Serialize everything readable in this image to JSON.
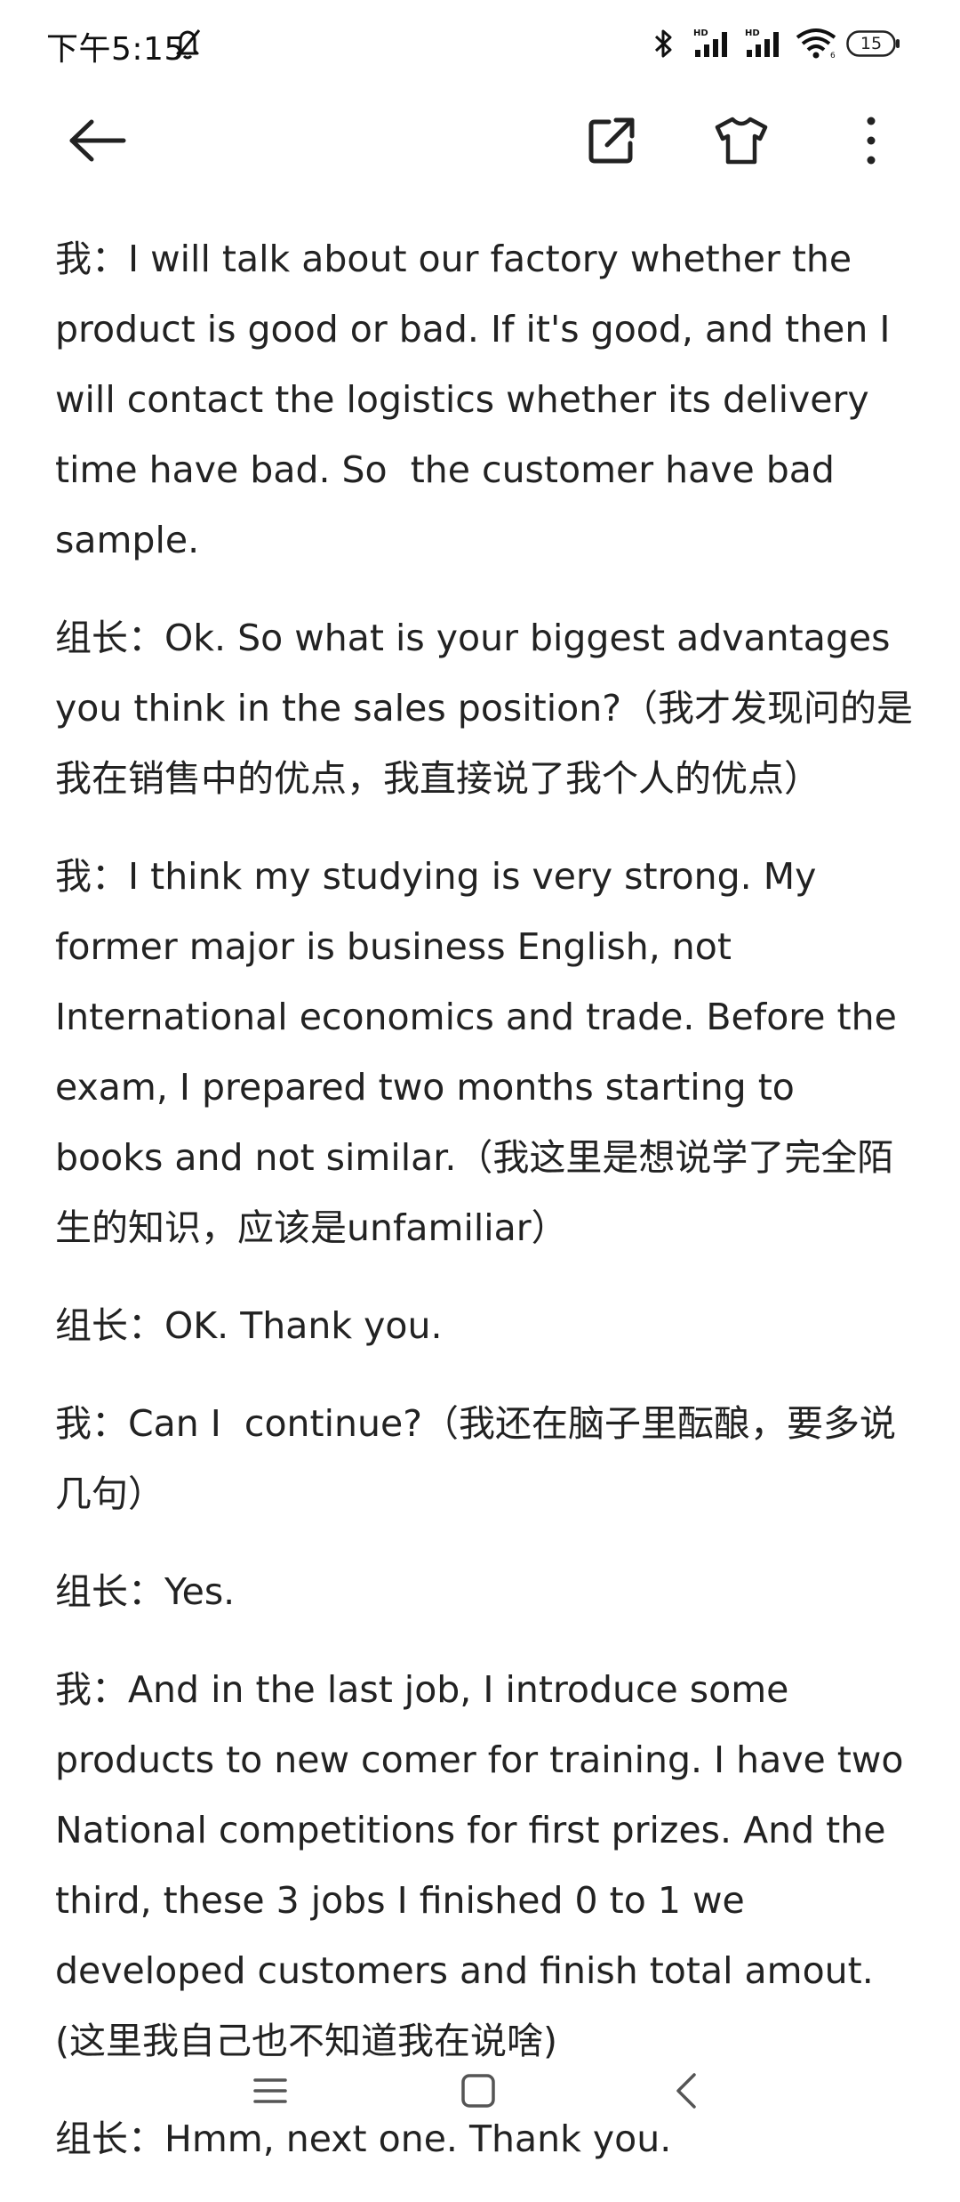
{
  "status_bar": {
    "time": "下午5:15",
    "battery": "15"
  },
  "toolbar": {
    "back_icon": "arrow-left-icon",
    "share_icon": "open-external-icon",
    "theme_icon": "tshirt-icon",
    "more_icon": "more-vertical-icon"
  },
  "document": {
    "paragraphs": [
      "我：I will talk about our factory whether the product is good or bad. If it's good, and then I will contact the logistics whether its delivery time have bad. So  the customer have bad sample.",
      "组长：Ok. So what is your biggest advantages you think in the sales position?（我才发现问的是我在销售中的优点，我直接说了我个人的优点）",
      "我：I think my studying is very strong. My former major is business English, not International economics and trade. Before the exam, I prepared two months starting to books and not similar.（我这里是想说学了完全陌生的知识，应该是unfamiliar）",
      "组长：OK. Thank you.",
      "我：Can I  continue?（我还在脑子里酝酿，要多说几句）",
      "组长：Yes.",
      "我：And in the last job, I introduce some products to new comer for training. I have two National competitions for first prizes. And the third, these 3 jobs I finished 0 to 1 we developed customers and finish total amout.(这里我自己也不知道我在说啥)",
      "组长：Hmm, next one. Thank you."
    ]
  }
}
